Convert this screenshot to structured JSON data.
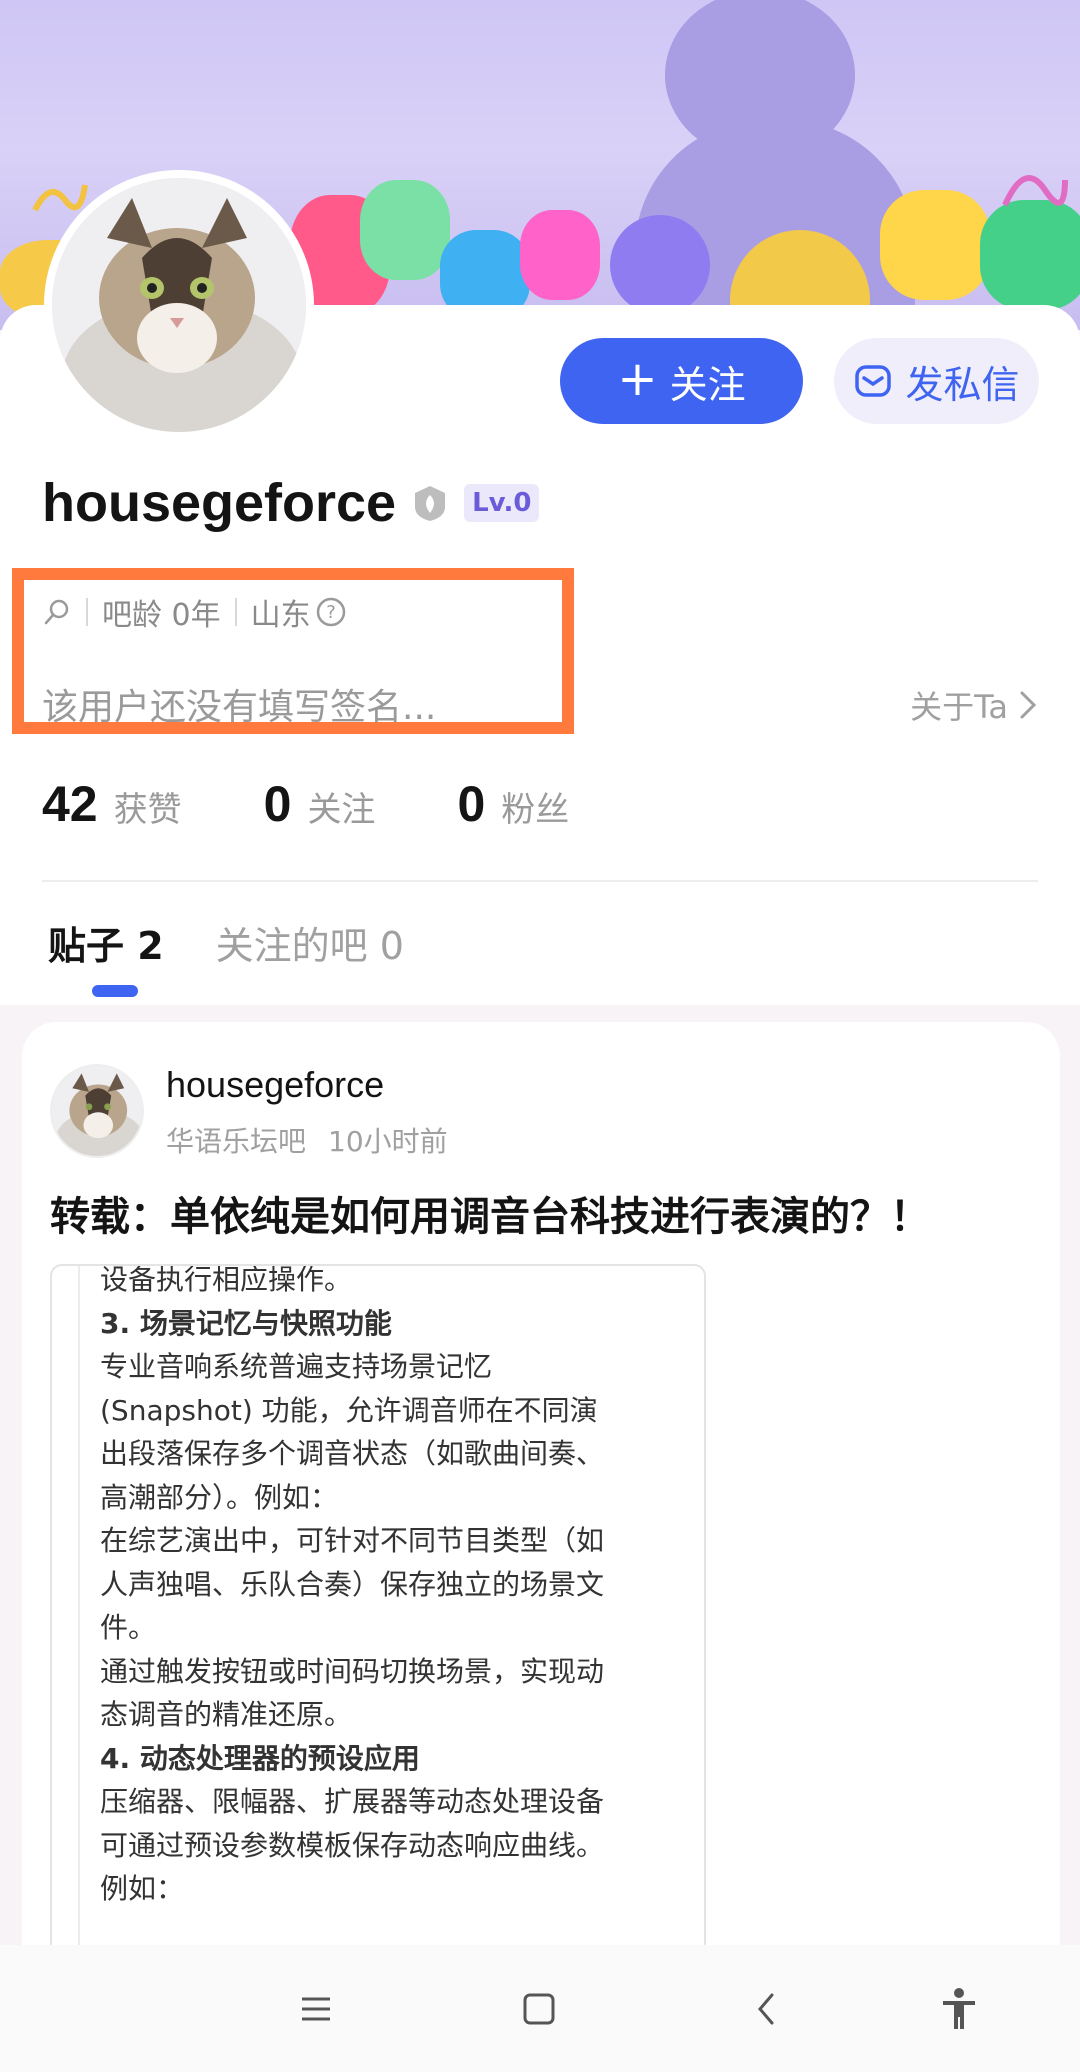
{
  "profile": {
    "username": "housegeforce",
    "level_badge": "Lv.0",
    "meta": {
      "search_icon": "search-icon",
      "age": "吧龄 0年",
      "location": "山东"
    },
    "signature": "该用户还没有填写签名...",
    "about_label": "关于Ta"
  },
  "actions": {
    "follow_label": "关注",
    "message_label": "发私信"
  },
  "stats": [
    {
      "value": "42",
      "label": "获赞"
    },
    {
      "value": "0",
      "label": "关注"
    },
    {
      "value": "0",
      "label": "粉丝"
    }
  ],
  "tabs": [
    {
      "label": "贴子 2",
      "active": true
    },
    {
      "label": "关注的吧 0",
      "active": false
    }
  ],
  "post": {
    "author": "housegeforce",
    "forum": "华语乐坛吧",
    "time": "10小时前",
    "title": "转载：单依纯是如何用调音台科技进行表演的？！",
    "content_lines": [
      {
        "text": "设备执行相应操作。",
        "bold": false
      },
      {
        "text": "3. 场景记忆与快照功能",
        "bold": true
      },
      {
        "text": "专业音响系统普遍支持场景记忆",
        "bold": false
      },
      {
        "text": "(Snapshot) 功能，允许调音师在不同演",
        "bold": false
      },
      {
        "text": "出段落保存多个调音状态（如歌曲间奏、",
        "bold": false
      },
      {
        "text": "高潮部分）。例如：",
        "bold": false
      },
      {
        "text": "在综艺演出中，可针对不同节目类型（如",
        "bold": false
      },
      {
        "text": "人声独唱、乐队合奏）保存独立的场景文",
        "bold": false
      },
      {
        "text": "件。",
        "bold": false
      },
      {
        "text": "通过触发按钮或时间码切换场景，实现动",
        "bold": false
      },
      {
        "text": "态调音的精准还原。",
        "bold": false
      },
      {
        "text": "4. 动态处理器的预设应用",
        "bold": true
      },
      {
        "text": "压缩器、限幅器、扩展器等动态处理设备",
        "bold": false
      },
      {
        "text": "可通过预设参数模板保存动态响应曲线。",
        "bold": false
      },
      {
        "text": "例如：",
        "bold": false
      }
    ]
  },
  "navbar": {
    "menu_icon": "menu-icon",
    "home_icon": "home-square-icon",
    "back_icon": "back-icon",
    "accessibility_icon": "accessibility-icon"
  },
  "colors": {
    "accent": "#3f64f1",
    "highlight": "#ff7a3c"
  }
}
